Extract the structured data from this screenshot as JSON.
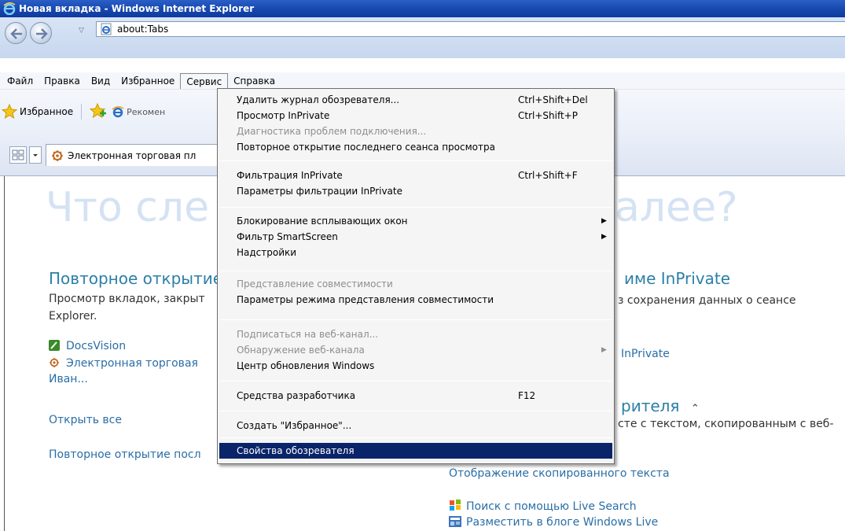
{
  "window": {
    "title": "Новая вкладка - Windows Internet Explorer"
  },
  "address_bar": {
    "url": "about:Tabs"
  },
  "menubar": {
    "items": [
      "Файл",
      "Правка",
      "Вид",
      "Избранное",
      "Сервис",
      "Справка"
    ]
  },
  "favorites_bar": {
    "favorites_label": "Избранное",
    "recommended": "Рекомен"
  },
  "tab": {
    "label": "Электронная торговая пл"
  },
  "content": {
    "hero_left": "Что сле",
    "hero_right": "алее?",
    "reopen_title": "Повторное открытие",
    "reopen_desc_1": "Просмотр вкладок, закрыт",
    "reopen_desc_2": "Explorer.",
    "docsvision": "DocsVision",
    "trading": "Электронная торговая",
    "ivan": "Иван...",
    "open_all": "Открыть все",
    "reopen_last": "Повторное открытие посл",
    "inprivate_title": "име InPrivate",
    "inprivate_desc": "з сохранения данных о сеансе",
    "inprivate_link": "InPrivate",
    "accel_title": "рителя",
    "accel_desc": "сте с текстом, скопированным с веб-",
    "show_copied": "Отображение скопированного текста",
    "live_search": "Поиск с помощью Live Search",
    "blog_live": "Разместить в блоге Windows Live"
  },
  "service_menu": {
    "items": [
      {
        "label": "Удалить журнал обозревателя...",
        "shortcut": "Ctrl+Shift+Del",
        "disabled": false
      },
      {
        "label": "Просмотр InPrivate",
        "shortcut": "Ctrl+Shift+P",
        "disabled": false
      },
      {
        "label": "Диагностика проблем подключения...",
        "shortcut": "",
        "disabled": true
      },
      {
        "label": "Повторное открытие последнего сеанса просмотра",
        "shortcut": "",
        "disabled": false
      },
      {
        "label": "Фильтрация InPrivate",
        "shortcut": "Ctrl+Shift+F",
        "disabled": false
      },
      {
        "label": "Параметры фильтрации InPrivate",
        "shortcut": "",
        "disabled": false
      },
      {
        "label": "Блокирование всплывающих окон",
        "shortcut": "",
        "disabled": false,
        "submenu": true
      },
      {
        "label": "Фильтр SmartScreen",
        "shortcut": "",
        "disabled": false,
        "submenu": true
      },
      {
        "label": "Надстройки",
        "shortcut": "",
        "disabled": false
      },
      {
        "label": "Представление совместимости",
        "shortcut": "",
        "disabled": true
      },
      {
        "label": "Параметры режима представления совместимости",
        "shortcut": "",
        "disabled": false
      },
      {
        "label": "Подписаться на веб-канал...",
        "shortcut": "",
        "disabled": true
      },
      {
        "label": "Обнаружение веб-канала",
        "shortcut": "",
        "disabled": true,
        "submenu": true
      },
      {
        "label": "Центр обновления Windows",
        "shortcut": "",
        "disabled": false
      },
      {
        "label": "Средства разработчика",
        "shortcut": "F12",
        "disabled": false
      },
      {
        "label": "Создать \"Избранное\"...",
        "shortcut": "",
        "disabled": false
      },
      {
        "label": "Свойства обозревателя",
        "shortcut": "",
        "disabled": false,
        "selected": true
      }
    ]
  },
  "colors": {
    "titlebar": "#1a4bb0",
    "menu_highlight": "#0a246a",
    "link": "#2a6ea6",
    "heading": "#2b7fa8",
    "hero": "#d4e2f4"
  }
}
